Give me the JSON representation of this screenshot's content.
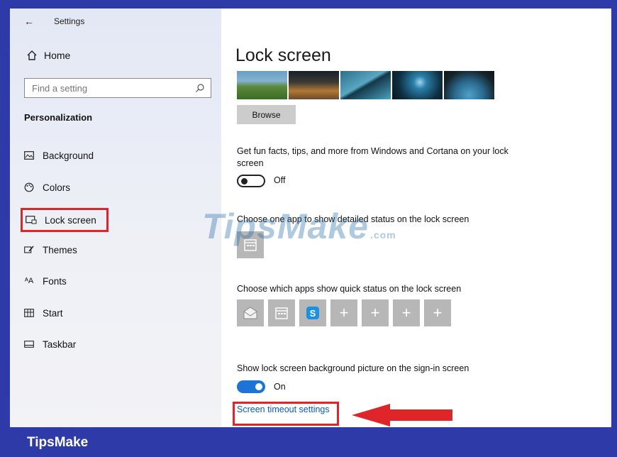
{
  "window": {
    "title": "Settings"
  },
  "sidebar": {
    "home_label": "Home",
    "search_placeholder": "Find a setting",
    "section_title": "Personalization",
    "items": [
      {
        "label": "Background",
        "icon": "picture-icon"
      },
      {
        "label": "Colors",
        "icon": "palette-icon"
      },
      {
        "label": "Lock screen",
        "icon": "lock-screen-icon",
        "selected": true
      },
      {
        "label": "Themes",
        "icon": "brush-icon"
      },
      {
        "label": "Fonts",
        "icon": "font-icon"
      },
      {
        "label": "Start",
        "icon": "start-icon"
      },
      {
        "label": "Taskbar",
        "icon": "taskbar-icon"
      }
    ]
  },
  "main": {
    "title": "Lock screen",
    "browse_label": "Browse",
    "fun_facts_text": "Get fun facts, tips, and more from Windows and Cortana on your lock screen",
    "fun_facts_state": "Off",
    "detailed_status_text": "Choose one app to show detailed status on the lock screen",
    "quick_status_text": "Choose which apps show quick status on the lock screen",
    "signin_text": "Show lock screen background picture on the sign-in screen",
    "signin_state": "On",
    "timeout_link": "Screen timeout settings"
  },
  "watermark": {
    "text": "TipsMake",
    "suffix": ".com"
  },
  "footer": {
    "brand": "TipsMake"
  },
  "colors": {
    "accent": "#2d3aa8",
    "highlight": "#e0252a",
    "toggle_on": "#1e73d8",
    "link": "#0a58c6"
  }
}
